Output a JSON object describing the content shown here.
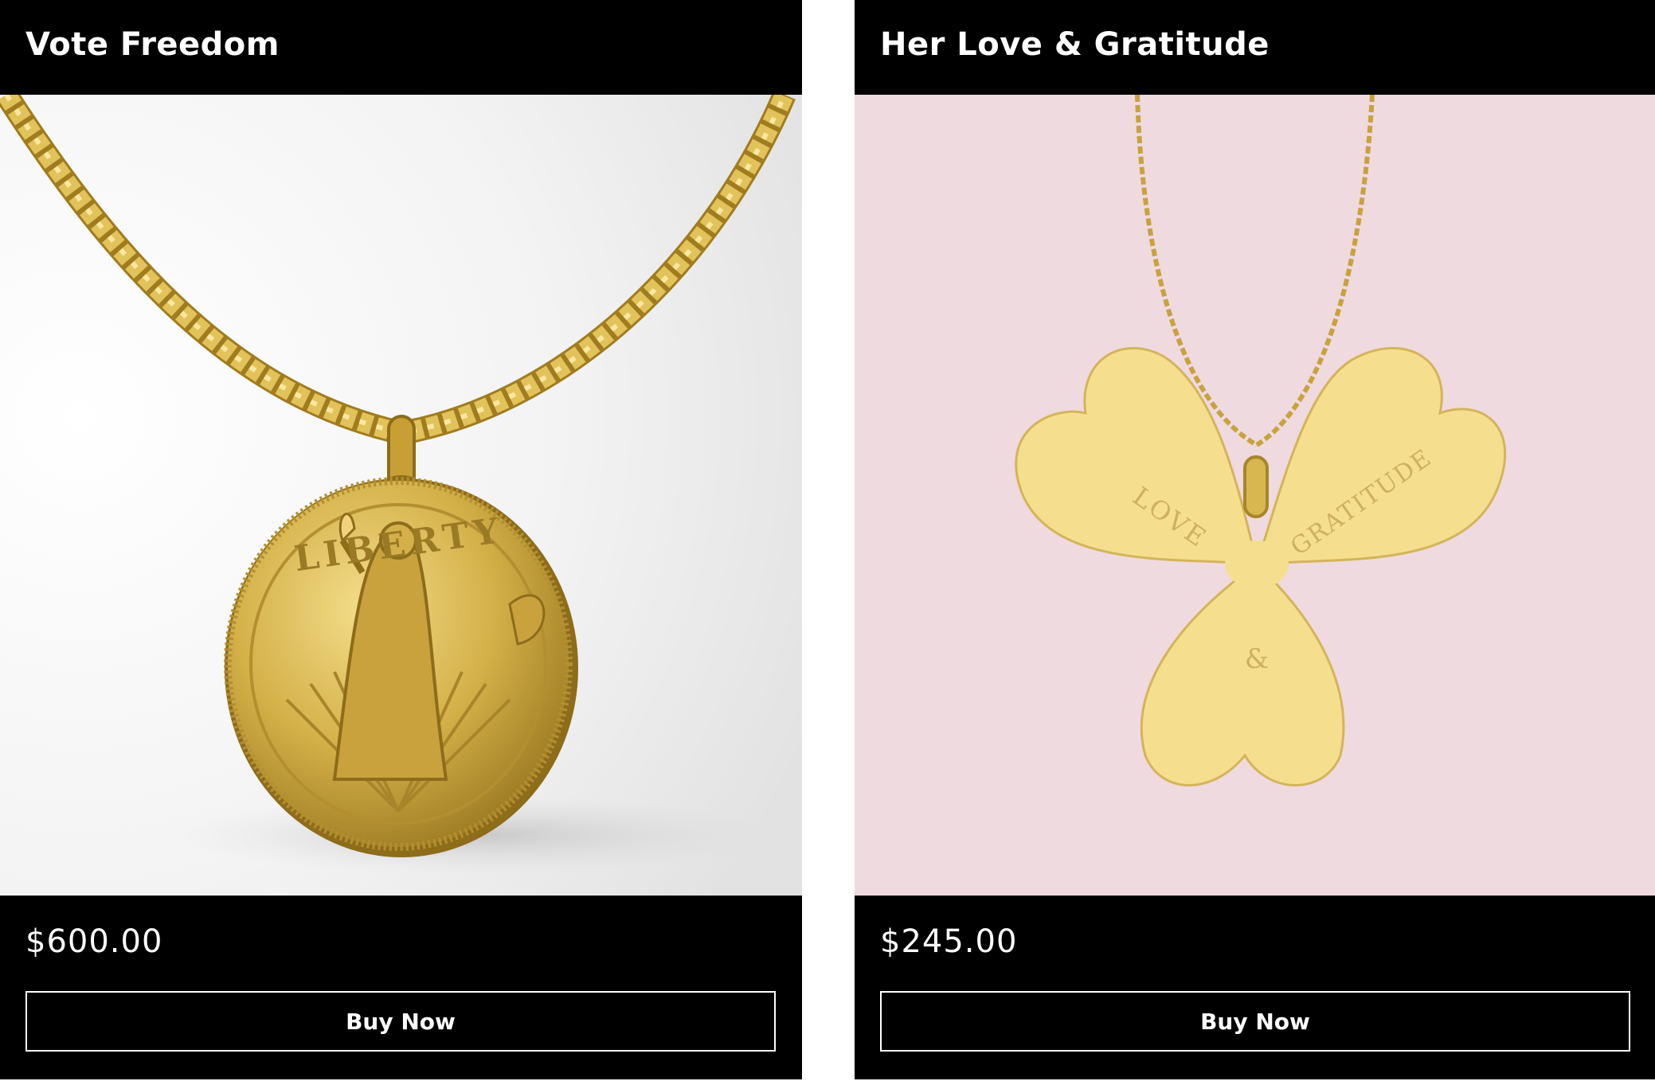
{
  "products": [
    {
      "title": "Vote Freedom",
      "image": {
        "subject": "gold Liberty coin pendant on curb chain",
        "background": "#ffffff",
        "coin_inscription": "LIBERTY"
      },
      "price": "$600.00",
      "button_label": "Buy Now"
    },
    {
      "title": "Her Love & Gratitude",
      "image": {
        "subject": "gold three-heart clover pendant on cable chain",
        "background": "#efdadf",
        "engravings": [
          "LOVE",
          "&",
          "GRATITUDE"
        ]
      },
      "price": "$245.00",
      "button_label": "Buy Now"
    }
  ],
  "colors": {
    "card_bg": "#000000",
    "text": "#ffffff",
    "gold": "#d8b64a",
    "clover_gold": "#f5df8f",
    "pink_bg": "#efdadf"
  }
}
